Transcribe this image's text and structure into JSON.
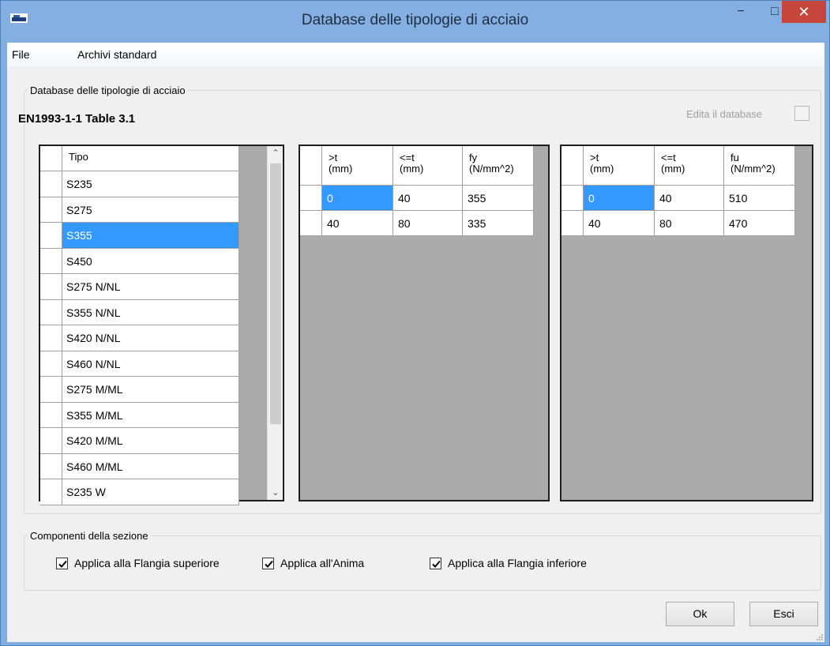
{
  "window": {
    "title": "Database delle tipologie di acciaio",
    "minimize_glyph": "−",
    "maximize_glyph": "□",
    "close_glyph": "✕",
    "app_icon": "app-icon"
  },
  "menu": {
    "items": [
      "File",
      "Archivi standard"
    ]
  },
  "db_group": {
    "legend": "Database delle tipologie di acciaio",
    "standard_label": "EN1993-1-1 Table 3.1",
    "edit_label": "Edita il database",
    "edit_checked": false
  },
  "tipo_grid": {
    "header": "Tipo",
    "rows": [
      "S235",
      "S275",
      "S355",
      "S450",
      "S275 N/NL",
      "S355 N/NL",
      "S420 N/NL",
      "S460 N/NL",
      "S275 M/ML",
      "S355 M/ML",
      "S420 M/ML",
      "S460 M/ML",
      "S235 W"
    ],
    "selected_index": 2,
    "scroll_up": "⌃",
    "scroll_down": "⌄"
  },
  "fy_grid": {
    "columns": [
      ">t\n(mm)",
      "<=t\n(mm)",
      "fy\n(N/mm^2)"
    ],
    "rows": [
      [
        "0",
        "40",
        "355"
      ],
      [
        "40",
        "80",
        "335"
      ]
    ]
  },
  "fu_grid": {
    "columns": [
      ">t\n(mm)",
      "<=t\n(mm)",
      "fu\n(N/mm^2)"
    ],
    "rows": [
      [
        "0",
        "40",
        "510"
      ],
      [
        "40",
        "80",
        "470"
      ]
    ]
  },
  "components_group": {
    "legend": "Componenti della sezione",
    "checks": [
      {
        "label": "Applica alla Flangia superiore",
        "checked": true
      },
      {
        "label": "Applica all'Anima",
        "checked": true
      },
      {
        "label": "Applica alla Flangia inferiore",
        "checked": true
      }
    ]
  },
  "buttons": {
    "ok": "Ok",
    "esci": "Esci"
  },
  "colors": {
    "title_bar": "#84afe2",
    "close_button": "#c7463b",
    "selection": "#3399ff"
  }
}
